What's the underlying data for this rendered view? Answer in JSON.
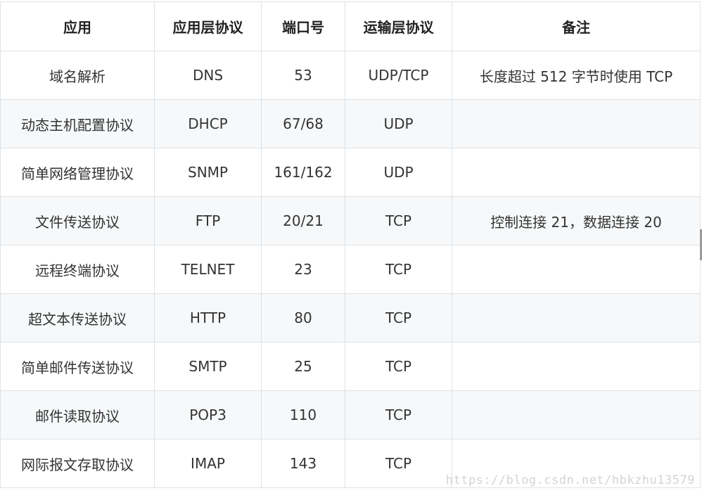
{
  "table": {
    "headers": [
      "应用",
      "应用层协议",
      "端口号",
      "运输层协议",
      "备注"
    ],
    "rows": [
      [
        "域名解析",
        "DNS",
        "53",
        "UDP/TCP",
        "长度超过 512 字节时使用 TCP"
      ],
      [
        "动态主机配置协议",
        "DHCP",
        "67/68",
        "UDP",
        ""
      ],
      [
        "简单网络管理协议",
        "SNMP",
        "161/162",
        "UDP",
        ""
      ],
      [
        "文件传送协议",
        "FTP",
        "20/21",
        "TCP",
        "控制连接 21，数据连接 20"
      ],
      [
        "远程终端协议",
        "TELNET",
        "23",
        "TCP",
        ""
      ],
      [
        "超文本传送协议",
        "HTTP",
        "80",
        "TCP",
        ""
      ],
      [
        "简单邮件传送协议",
        "SMTP",
        "25",
        "TCP",
        ""
      ],
      [
        "邮件读取协议",
        "POP3",
        "110",
        "TCP",
        ""
      ],
      [
        "网际报文存取协议",
        "IMAP",
        "143",
        "TCP",
        ""
      ]
    ]
  },
  "watermark": "https://blog.csdn.net/hbkzhu13579"
}
